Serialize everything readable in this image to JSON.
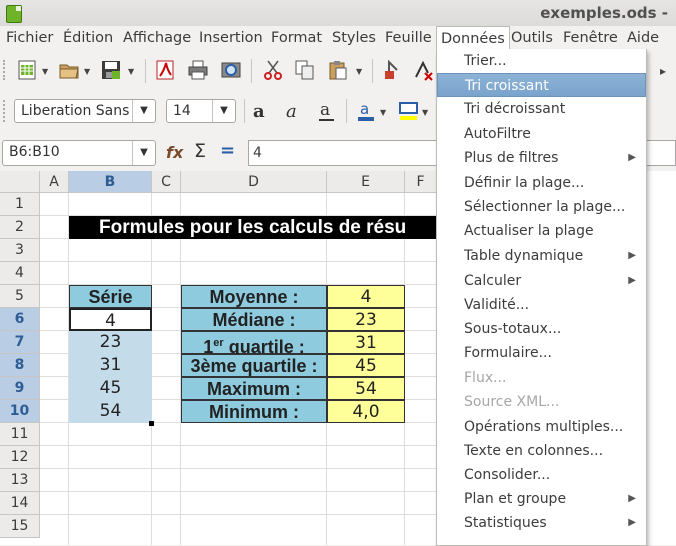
{
  "window": {
    "title": "exemples.ods -"
  },
  "menubar": {
    "items": [
      "Fichier",
      "Édition",
      "Affichage",
      "Insertion",
      "Format",
      "Styles",
      "Feuille",
      "Données",
      "Outils",
      "Fenêtre",
      "Aide"
    ],
    "open": "Données"
  },
  "toolbar": {
    "font_name": "Liberation Sans",
    "font_size": "14"
  },
  "formula_bar": {
    "name_box": "B6:B10",
    "content": "4",
    "fx_icon": "function-wizard-icon",
    "sigma_icon": "sum-icon",
    "equals_icon": "formula-icon"
  },
  "grid": {
    "columns": [
      "A",
      "B",
      "C",
      "D",
      "E",
      "F"
    ],
    "selected_column": "B",
    "rows": [
      "1",
      "2",
      "3",
      "4",
      "5",
      "6",
      "7",
      "8",
      "9",
      "10",
      "11",
      "12",
      "13",
      "14",
      "15"
    ],
    "selected_rows": [
      "6",
      "7",
      "8",
      "9",
      "10"
    ],
    "title_cell": "Formules pour les calculs de résu",
    "serie_header": "Série",
    "serie_values": [
      "4",
      "23",
      "31",
      "45",
      "54"
    ],
    "stat_labels": [
      "Moyenne :",
      "Médiane :",
      "quartile :",
      "3ème quartile :",
      "Maximum :",
      "Minimum :"
    ],
    "quartile_prefix": "1",
    "quartile_sup": "er",
    "stat_values": [
      "4",
      "23",
      "31",
      "45",
      "54",
      "4,0"
    ]
  },
  "dropdown": {
    "items": [
      {
        "label": "Trier...",
        "state": "normal",
        "submenu": false
      },
      {
        "label": "Tri croissant",
        "state": "highlighted",
        "submenu": false
      },
      {
        "label": "Tri décroissant",
        "state": "normal",
        "submenu": false
      },
      {
        "label": "AutoFiltre",
        "state": "normal",
        "submenu": false
      },
      {
        "label": "Plus de filtres",
        "state": "normal",
        "submenu": true
      },
      {
        "label": "Définir la plage...",
        "state": "normal",
        "submenu": false
      },
      {
        "label": "Sélectionner la plage...",
        "state": "normal",
        "submenu": false
      },
      {
        "label": "Actualiser la plage",
        "state": "normal",
        "submenu": false
      },
      {
        "label": "Table dynamique",
        "state": "normal",
        "submenu": true
      },
      {
        "label": "Calculer",
        "state": "normal",
        "submenu": true
      },
      {
        "label": "Validité...",
        "state": "normal",
        "submenu": false
      },
      {
        "label": "Sous-totaux...",
        "state": "normal",
        "submenu": false
      },
      {
        "label": "Formulaire...",
        "state": "normal",
        "submenu": false
      },
      {
        "label": "Flux...",
        "state": "disabled",
        "submenu": false
      },
      {
        "label": "Source XML...",
        "state": "disabled",
        "submenu": false
      },
      {
        "label": "Opérations multiples...",
        "state": "normal",
        "submenu": false
      },
      {
        "label": "Texte en colonnes...",
        "state": "normal",
        "submenu": false
      },
      {
        "label": "Consolider...",
        "state": "normal",
        "submenu": false
      },
      {
        "label": "Plan et groupe",
        "state": "normal",
        "submenu": true
      },
      {
        "label": "Statistiques",
        "state": "normal",
        "submenu": true
      }
    ]
  },
  "colors": {
    "header_blue": "#8fcbdf",
    "value_yellow": "#ffff99",
    "selection": "#c4dbea",
    "menu_highlight": "#7aa3cc",
    "title_bg": "#000000"
  }
}
